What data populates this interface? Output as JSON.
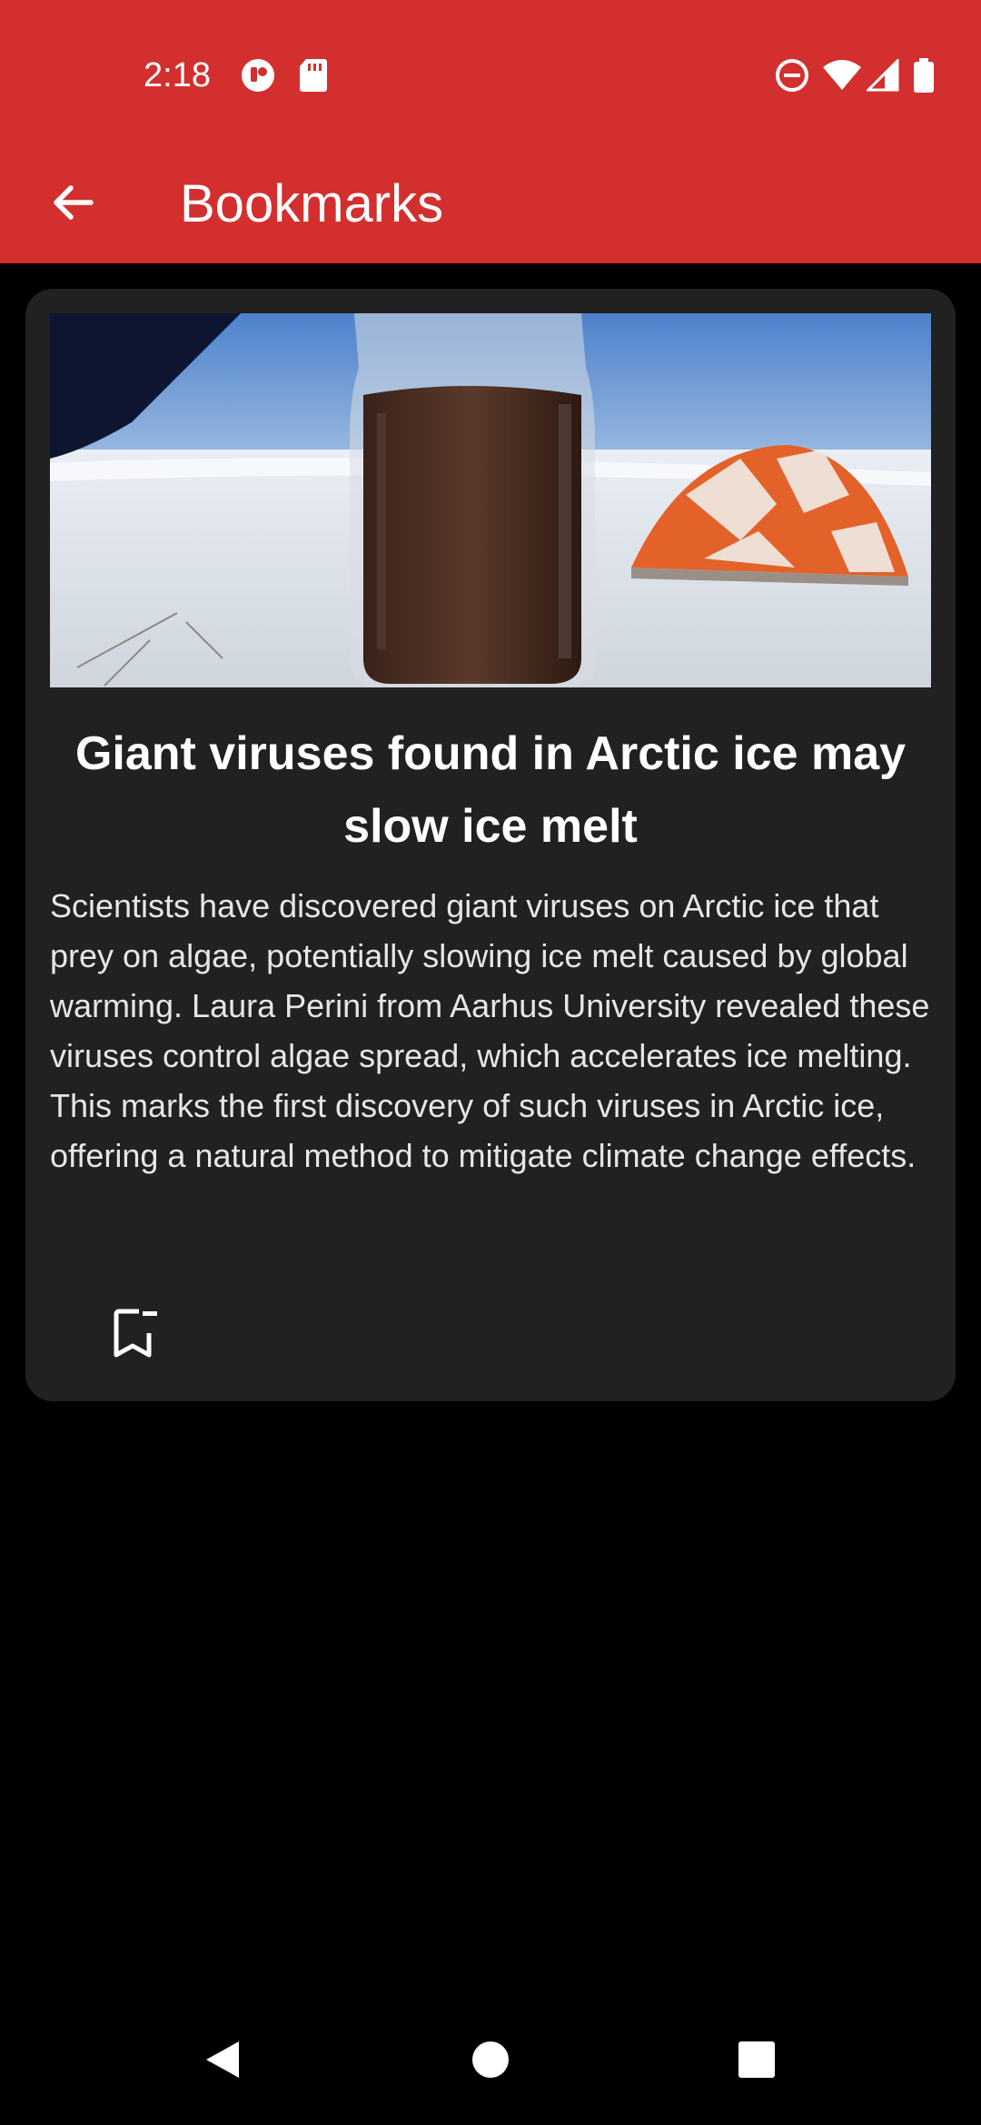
{
  "status_bar": {
    "time": "2:18",
    "icons": [
      "notification-app-icon",
      "sd-card-icon",
      "do-not-disturb-icon",
      "wifi-icon",
      "cell-signal-icon",
      "battery-icon"
    ]
  },
  "app_bar": {
    "title": "Bookmarks",
    "background_color": "#d32f2f",
    "back_icon": "arrow-left-icon"
  },
  "bookmarks": [
    {
      "image": "arctic-ice-bottle-tent-photo",
      "title": "Giant viruses found in Arctic ice may slow ice melt",
      "summary": "Scientists have discovered giant viruses on Arctic ice that prey on algae, potentially slowing ice melt caused by global warming. Laura Perini from Aarhus University revealed these viruses control algae spread, which accelerates ice melting. This marks the first discovery of such viruses in Arctic ice, offering a natural method to mitigate climate change effects.",
      "bookmark_icon": "bookmark-remove-icon"
    }
  ],
  "nav_bar": {
    "buttons": [
      "back-triangle-icon",
      "home-circle-icon",
      "recents-square-icon"
    ]
  }
}
